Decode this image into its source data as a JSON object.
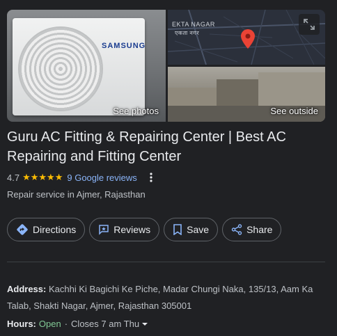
{
  "photos": {
    "brand_text": "SAMSUNG",
    "see_photos_label": "See photos",
    "map_area_latin": "EKTA NAGAR",
    "map_area_devanagari": "एकता नगर",
    "see_outside_label": "See outside"
  },
  "place": {
    "title": "Guru AC Fitting & Repairing Center | Best AC Repairing and Fitting Center",
    "rating": "4.7",
    "stars": "★★★★★",
    "rating_fraction": 0.94,
    "reviews_label": "9 Google reviews",
    "category": "Repair service in Ajmer, Rajasthan"
  },
  "actions": {
    "directions": "Directions",
    "reviews": "Reviews",
    "save": "Save",
    "share": "Share"
  },
  "details": {
    "address_label": "Address:",
    "address_value": "Kachhi Ki Bagichi Ke Piche, Madar Chungi Naka, 135/13, Aam Ka Talab, Shakti Nagar, Ajmer, Rajasthan 305001",
    "hours_label": "Hours:",
    "hours_status": "Open",
    "hours_separator": "·",
    "hours_next": "Closes 7 am Thu"
  },
  "colors": {
    "background": "#202124",
    "link": "#8ab4f8",
    "star": "#fbbc04",
    "open": "#81c995",
    "pin": "#ea4335"
  },
  "icons": [
    "expand-icon",
    "map-pin-icon",
    "directions-icon",
    "reviews-icon",
    "bookmark-icon",
    "share-icon",
    "more-vert-icon",
    "caret-down-icon"
  ]
}
